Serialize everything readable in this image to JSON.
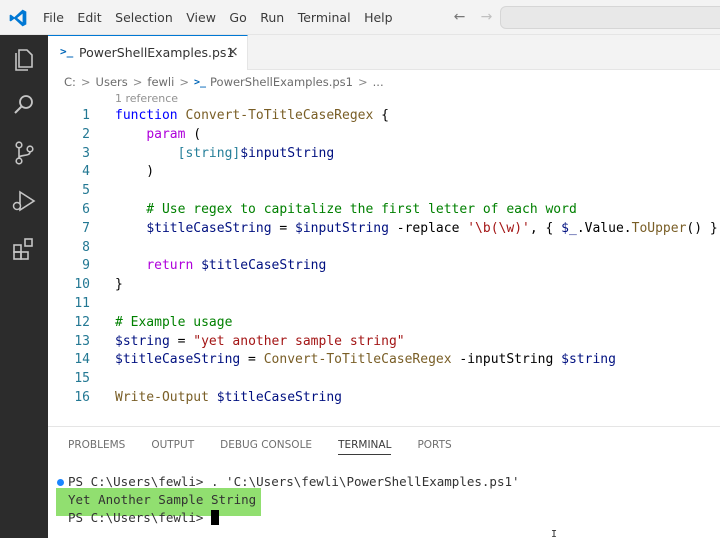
{
  "menu": [
    "File",
    "Edit",
    "Selection",
    "View",
    "Go",
    "Run",
    "Terminal",
    "Help"
  ],
  "nav": {
    "back": "←",
    "forward": "→"
  },
  "colors": {
    "accent": "#0078d4",
    "activitybar": "#2c2c2c",
    "highlight": "#7ed957"
  },
  "tab": {
    "icon": ">_",
    "label": "PowerShellExamples.ps1",
    "close": "×"
  },
  "breadcrumb": {
    "parts": [
      "C:",
      "Users",
      "fewli"
    ],
    "file": "PowerShellExamples.ps1",
    "more": "...",
    "sep": ">",
    "file_icon": ">_"
  },
  "codelens": "1 reference",
  "lines": [
    {
      "n": "1",
      "tokens": [
        [
          "kw",
          "function "
        ],
        [
          "fn",
          "Convert-ToTitleCaseRegex"
        ],
        [
          "plain",
          " {"
        ]
      ]
    },
    {
      "n": "2",
      "tokens": [
        [
          "plain",
          "    "
        ],
        [
          "ctl",
          "param"
        ],
        [
          "plain",
          " ("
        ]
      ]
    },
    {
      "n": "3",
      "tokens": [
        [
          "plain",
          "        "
        ],
        [
          "typ",
          "[string]"
        ],
        [
          "var",
          "$inputString"
        ]
      ]
    },
    {
      "n": "4",
      "tokens": [
        [
          "plain",
          "    )"
        ]
      ]
    },
    {
      "n": "5",
      "tokens": []
    },
    {
      "n": "6",
      "tokens": [
        [
          "cmt",
          "    # Use regex to capitalize the first letter of each word"
        ]
      ]
    },
    {
      "n": "7",
      "tokens": [
        [
          "plain",
          "    "
        ],
        [
          "var",
          "$titleCaseString"
        ],
        [
          "plain",
          " = "
        ],
        [
          "var",
          "$inputString"
        ],
        [
          "plain",
          " -replace "
        ],
        [
          "str",
          "'\\b(\\w)'"
        ],
        [
          "plain",
          ", { "
        ],
        [
          "var",
          "$_"
        ],
        [
          "plain",
          ".Value."
        ],
        [
          "fn",
          "ToUpper"
        ],
        [
          "plain",
          "() }"
        ]
      ]
    },
    {
      "n": "8",
      "tokens": []
    },
    {
      "n": "9",
      "tokens": [
        [
          "plain",
          "    "
        ],
        [
          "ctl",
          "return"
        ],
        [
          "plain",
          " "
        ],
        [
          "var",
          "$titleCaseString"
        ]
      ]
    },
    {
      "n": "10",
      "tokens": [
        [
          "plain",
          "}"
        ]
      ]
    },
    {
      "n": "11",
      "tokens": []
    },
    {
      "n": "12",
      "tokens": [
        [
          "cmt",
          "# Example usage"
        ]
      ]
    },
    {
      "n": "13",
      "tokens": [
        [
          "var",
          "$string"
        ],
        [
          "plain",
          " = "
        ],
        [
          "str",
          "\"yet another sample string\""
        ]
      ]
    },
    {
      "n": "14",
      "tokens": [
        [
          "var",
          "$titleCaseString"
        ],
        [
          "plain",
          " = "
        ],
        [
          "fn",
          "Convert-ToTitleCaseRegex"
        ],
        [
          "plain",
          " -inputString "
        ],
        [
          "var",
          "$string"
        ]
      ]
    },
    {
      "n": "15",
      "tokens": []
    },
    {
      "n": "16",
      "tokens": [
        [
          "fn",
          "Write-Output"
        ],
        [
          "plain",
          " "
        ],
        [
          "var",
          "$titleCaseString"
        ]
      ]
    }
  ],
  "panel": {
    "tabs": [
      "PROBLEMS",
      "OUTPUT",
      "DEBUG CONSOLE",
      "TERMINAL",
      "PORTS"
    ],
    "active_tab": "TERMINAL"
  },
  "terminal": {
    "line1": "PS C:\\Users\\fewli> . 'C:\\Users\\fewli\\PowerShellExamples.ps1'",
    "line2": "Yet Another Sample String",
    "line3": "PS C:\\Users\\fewli> "
  },
  "mouse_cursor": "I"
}
